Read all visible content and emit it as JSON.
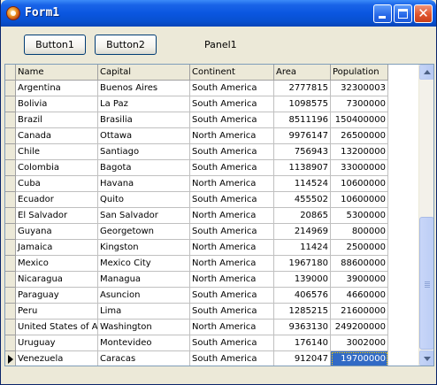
{
  "window": {
    "title": "Form1"
  },
  "toolbar": {
    "button1_label": "Button1",
    "button2_label": "Button2",
    "panel_label": "Panel1"
  },
  "grid": {
    "columns": [
      "Name",
      "Capital",
      "Continent",
      "Area",
      "Population"
    ],
    "rows": [
      [
        "Argentina",
        "Buenos Aires",
        "South America",
        "2777815",
        "32300003"
      ],
      [
        "Bolivia",
        "La Paz",
        "South America",
        "1098575",
        "7300000"
      ],
      [
        "Brazil",
        "Brasilia",
        "South America",
        "8511196",
        "150400000"
      ],
      [
        "Canada",
        "Ottawa",
        "North America",
        "9976147",
        "26500000"
      ],
      [
        "Chile",
        "Santiago",
        "South America",
        "756943",
        "13200000"
      ],
      [
        "Colombia",
        "Bagota",
        "South America",
        "1138907",
        "33000000"
      ],
      [
        "Cuba",
        "Havana",
        "North America",
        "114524",
        "10600000"
      ],
      [
        "Ecuador",
        "Quito",
        "South America",
        "455502",
        "10600000"
      ],
      [
        "El Salvador",
        "San Salvador",
        "North America",
        "20865",
        "5300000"
      ],
      [
        "Guyana",
        "Georgetown",
        "South America",
        "214969",
        "800000"
      ],
      [
        "Jamaica",
        "Kingston",
        "North America",
        "11424",
        "2500000"
      ],
      [
        "Mexico",
        "Mexico City",
        "North America",
        "1967180",
        "88600000"
      ],
      [
        "Nicaragua",
        "Managua",
        "North America",
        "139000",
        "3900000"
      ],
      [
        "Paraguay",
        "Asuncion",
        "South America",
        "406576",
        "4660000"
      ],
      [
        "Peru",
        "Lima",
        "South America",
        "1285215",
        "21600000"
      ],
      [
        "United States of America",
        "Washington",
        "North America",
        "9363130",
        "249200000"
      ],
      [
        "Uruguay",
        "Montevideo",
        "South America",
        "176140",
        "3002000"
      ],
      [
        "Venezuela",
        "Caracas",
        "South America",
        "912047",
        "19700000"
      ]
    ],
    "current_row": 17,
    "selected_column": 4
  },
  "colors": {
    "selection": "#316ac5",
    "title_bar": "#0a56e0",
    "window_bg": "#ece9d8"
  },
  "icons": {
    "app": "app-icon",
    "minimize": "minimize-icon",
    "maximize": "maximize-icon",
    "close": "close-icon",
    "current_row": "current-row-arrow-icon"
  }
}
